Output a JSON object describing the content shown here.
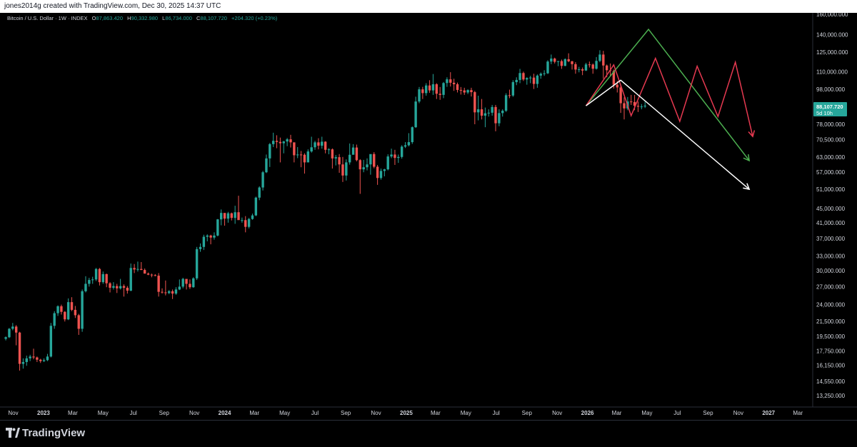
{
  "header": {
    "caption": "jones2014g created with TradingView.com, Dec 30, 2025 14:37 UTC"
  },
  "legend": {
    "symbol": "Bitcoin / U.S. Dollar · 1W · INDEX",
    "open_label": "O",
    "open": "87,863.420",
    "high_label": "H",
    "high": "90,332.980",
    "low_label": "L",
    "low": "86,734.000",
    "close_label": "C",
    "close": "88,107.720",
    "change": "+204.320 (+0.23%)"
  },
  "price_tag": {
    "price": "88,107.720",
    "countdown": "5d 10h"
  },
  "footer": {
    "brand": "TradingView"
  },
  "colors": {
    "up": "#26a69a",
    "down": "#ef5350",
    "background": "#000000",
    "green_path": "#4caf50",
    "red_path": "#e53950",
    "white_path": "#ffffff"
  },
  "chart_data": {
    "type": "candlestick",
    "timeframe": "1W",
    "scale": "log",
    "grid": false,
    "y_ticks": [
      13250,
      14550,
      16150,
      17750,
      19500,
      21500,
      24000,
      27000,
      30000,
      33000,
      37000,
      41000,
      45000,
      51000,
      57000,
      63000,
      70500,
      78000,
      88000,
      98000,
      110000,
      125000,
      140000,
      160000
    ],
    "y_tick_labels": [
      "13,250.000",
      "14,550.000",
      "16,150.000",
      "17,750.000",
      "19,500.000",
      "21,500.000",
      "24,000.000",
      "27,000.000",
      "30,000.000",
      "33,000.000",
      "37,000.000",
      "41,000.000",
      "45,000.000",
      "51,000.000",
      "57,000.000",
      "63,000.000",
      "70,500.000",
      "78,000.000",
      "88,000.000",
      "98,000.000",
      "110,000.000",
      "125,000.000",
      "140,000.000",
      "160,000.000"
    ],
    "x_ticks": [
      {
        "label": "Nov",
        "date": "2022-11-01"
      },
      {
        "label": "2023",
        "date": "2023-01-01"
      },
      {
        "label": "Mar",
        "date": "2023-03-01"
      },
      {
        "label": "May",
        "date": "2023-05-01"
      },
      {
        "label": "Jul",
        "date": "2023-07-01"
      },
      {
        "label": "Sep",
        "date": "2023-09-01"
      },
      {
        "label": "Nov",
        "date": "2023-11-01"
      },
      {
        "label": "2024",
        "date": "2024-01-01"
      },
      {
        "label": "Mar",
        "date": "2024-03-01"
      },
      {
        "label": "May",
        "date": "2024-05-01"
      },
      {
        "label": "Jul",
        "date": "2024-07-01"
      },
      {
        "label": "Sep",
        "date": "2024-09-01"
      },
      {
        "label": "Nov",
        "date": "2024-11-01"
      },
      {
        "label": "2025",
        "date": "2025-01-01"
      },
      {
        "label": "Mar",
        "date": "2025-03-01"
      },
      {
        "label": "May",
        "date": "2025-05-01"
      },
      {
        "label": "Jul",
        "date": "2025-07-01"
      },
      {
        "label": "Sep",
        "date": "2025-09-01"
      },
      {
        "label": "Nov",
        "date": "2025-11-01"
      },
      {
        "label": "2026",
        "date": "2026-01-01"
      },
      {
        "label": "Mar",
        "date": "2026-03-01"
      },
      {
        "label": "May",
        "date": "2026-05-01"
      },
      {
        "label": "Jul",
        "date": "2026-07-01"
      },
      {
        "label": "Sep",
        "date": "2026-09-01"
      },
      {
        "label": "Nov",
        "date": "2026-11-01"
      },
      {
        "label": "2027",
        "date": "2027-01-01"
      },
      {
        "label": "Mar",
        "date": "2027-03-01"
      }
    ],
    "x_range": [
      "2022-10-14",
      "2027-03-28"
    ],
    "candles_start": "2022-10-17",
    "candle_interval_days": 7,
    "candles": [
      [
        19200,
        19500,
        19000,
        19400
      ],
      [
        19400,
        20600,
        19300,
        20500
      ],
      [
        20500,
        21300,
        20300,
        20800
      ],
      [
        20800,
        21000,
        18400,
        20000
      ],
      [
        20000,
        20100,
        15600,
        16300
      ],
      [
        16300,
        16900,
        15800,
        16500
      ],
      [
        16500,
        17200,
        16100,
        16900
      ],
      [
        16900,
        17300,
        16600,
        17100
      ],
      [
        17100,
        18000,
        16800,
        17000
      ],
      [
        17000,
        17100,
        16500,
        16750
      ],
      [
        16750,
        16850,
        16400,
        16600
      ],
      [
        16600,
        16900,
        16500,
        16700
      ],
      [
        16700,
        17400,
        16600,
        17100
      ],
      [
        17100,
        21300,
        17000,
        20900
      ],
      [
        20900,
        23000,
        20500,
        22700
      ],
      [
        22700,
        23900,
        22300,
        23750
      ],
      [
        23750,
        24000,
        22500,
        22900
      ],
      [
        22900,
        23000,
        21500,
        21800
      ],
      [
        21800,
        25000,
        21700,
        24400
      ],
      [
        24400,
        25200,
        23000,
        23200
      ],
      [
        23200,
        23800,
        22000,
        22400
      ],
      [
        22400,
        22600,
        19700,
        20500
      ],
      [
        20500,
        26500,
        20100,
        26200
      ],
      [
        26200,
        28900,
        26000,
        27500
      ],
      [
        27500,
        28600,
        27000,
        28200
      ],
      [
        28200,
        28800,
        27500,
        28300
      ],
      [
        28300,
        30500,
        28000,
        30300
      ],
      [
        30300,
        30500,
        27200,
        27800
      ],
      [
        27800,
        29800,
        27500,
        29300
      ],
      [
        29300,
        29400,
        26900,
        27600
      ],
      [
        27600,
        27800,
        26000,
        26800
      ],
      [
        26800,
        27800,
        26500,
        27100
      ],
      [
        27100,
        27500,
        25900,
        26700
      ],
      [
        26700,
        28400,
        26500,
        27100
      ],
      [
        27100,
        27400,
        25300,
        26800
      ],
      [
        26800,
        27100,
        25800,
        26300
      ],
      [
        26300,
        31400,
        26200,
        30500
      ],
      [
        30500,
        31300,
        29500,
        30200
      ],
      [
        30200,
        31800,
        29800,
        30300
      ],
      [
        30300,
        31700,
        30100,
        30100
      ],
      [
        30100,
        30400,
        29400,
        29400
      ],
      [
        29400,
        29600,
        29100,
        29200
      ],
      [
        29200,
        29400,
        28700,
        29100
      ],
      [
        29100,
        29300,
        28900,
        29000
      ],
      [
        29000,
        29500,
        25300,
        26100
      ],
      [
        26100,
        26700,
        25800,
        26000
      ],
      [
        26000,
        28100,
        25500,
        25900
      ],
      [
        25900,
        26400,
        25700,
        26200
      ],
      [
        26200,
        26500,
        24900,
        25800
      ],
      [
        25800,
        26900,
        25600,
        26500
      ],
      [
        26500,
        28300,
        26400,
        27000
      ],
      [
        27000,
        28600,
        26700,
        28400
      ],
      [
        28400,
        28000,
        26500,
        27500
      ],
      [
        27500,
        28300,
        26600,
        26900
      ],
      [
        26900,
        28700,
        26800,
        28500
      ],
      [
        28500,
        35000,
        28200,
        34500
      ],
      [
        34500,
        35800,
        33900,
        35000
      ],
      [
        35000,
        37900,
        34300,
        37400
      ],
      [
        37400,
        38000,
        36300,
        37700
      ],
      [
        37700,
        37900,
        35600,
        37200
      ],
      [
        37200,
        38500,
        36700,
        37700
      ],
      [
        37700,
        42000,
        37500,
        41900
      ],
      [
        41900,
        44700,
        40300,
        43700
      ],
      [
        43700,
        43400,
        40200,
        42100
      ],
      [
        42100,
        44000,
        41000,
        43600
      ],
      [
        43600,
        43800,
        41600,
        42300
      ],
      [
        42300,
        45800,
        40700,
        43900
      ],
      [
        43900,
        48900,
        42000,
        41700
      ],
      [
        41700,
        42400,
        41000,
        41700
      ],
      [
        41700,
        42800,
        38500,
        39900
      ],
      [
        39900,
        42300,
        39500,
        42000
      ],
      [
        42000,
        43500,
        41800,
        43000
      ],
      [
        43000,
        48600,
        42800,
        48300
      ],
      [
        48300,
        52000,
        47500,
        51600
      ],
      [
        51600,
        57500,
        50600,
        57000
      ],
      [
        57000,
        64000,
        56700,
        62400
      ],
      [
        62400,
        69000,
        59000,
        68500
      ],
      [
        68500,
        73800,
        67200,
        70000
      ],
      [
        70000,
        72600,
        66700,
        69500
      ],
      [
        69500,
        71500,
        60800,
        68900
      ],
      [
        68900,
        70000,
        64500,
        69700
      ],
      [
        69700,
        71300,
        67600,
        70700
      ],
      [
        70700,
        72800,
        67000,
        69300
      ],
      [
        69300,
        69300,
        60800,
        63700
      ],
      [
        63700,
        67200,
        62500,
        64000
      ],
      [
        64000,
        65500,
        58900,
        63900
      ],
      [
        63900,
        64500,
        56500,
        60800
      ],
      [
        60800,
        66200,
        60800,
        65300
      ],
      [
        65300,
        71900,
        64800,
        67100
      ],
      [
        67100,
        70000,
        66000,
        69300
      ],
      [
        69300,
        71200,
        66200,
        67800
      ],
      [
        67800,
        71900,
        66500,
        69600
      ],
      [
        69600,
        69800,
        64500,
        66000
      ],
      [
        66000,
        66700,
        64100,
        66200
      ],
      [
        66200,
        66600,
        58400,
        62400
      ],
      [
        62400,
        63800,
        59600,
        62900
      ],
      [
        62900,
        64200,
        56800,
        60000
      ],
      [
        60000,
        63000,
        53500,
        55800
      ],
      [
        55800,
        62000,
        54000,
        60800
      ],
      [
        60800,
        68800,
        59900,
        63900
      ],
      [
        63900,
        68500,
        65600,
        67000
      ],
      [
        67000,
        68300,
        61200,
        61700
      ],
      [
        61700,
        62100,
        49500,
        58100
      ],
      [
        58100,
        61800,
        57000,
        58900
      ],
      [
        58900,
        62400,
        57700,
        60000
      ],
      [
        60000,
        61800,
        56100,
        64200
      ],
      [
        64200,
        65000,
        58500,
        59100
      ],
      [
        59100,
        59800,
        52500,
        54900
      ],
      [
        54900,
        58400,
        54300,
        57500
      ],
      [
        57500,
        58300,
        55500,
        58100
      ],
      [
        58100,
        64100,
        57700,
        63200
      ],
      [
        63200,
        66500,
        62500,
        64000
      ],
      [
        64000,
        66000,
        59800,
        62600
      ],
      [
        62600,
        64000,
        60600,
        63000
      ],
      [
        63000,
        68000,
        62300,
        67400
      ],
      [
        67400,
        69400,
        66800,
        68000
      ],
      [
        68000,
        73600,
        67500,
        69400
      ],
      [
        69400,
        76900,
        68600,
        76500
      ],
      [
        76500,
        93400,
        76200,
        90500
      ],
      [
        90500,
        99500,
        89500,
        98000
      ],
      [
        98000,
        99600,
        92000,
        95600
      ],
      [
        95600,
        102000,
        94000,
        100500
      ],
      [
        100500,
        104000,
        95800,
        97300
      ],
      [
        97300,
        108300,
        94500,
        101300
      ],
      [
        101300,
        102000,
        92000,
        95200
      ],
      [
        95200,
        99500,
        91500,
        94500
      ],
      [
        94500,
        102800,
        92500,
        102100
      ],
      [
        102100,
        106000,
        99600,
        104600
      ],
      [
        104600,
        109600,
        99800,
        102300
      ],
      [
        102300,
        105000,
        97000,
        101300
      ],
      [
        101300,
        102400,
        96000,
        97600
      ],
      [
        97600,
        99500,
        94700,
        97300
      ],
      [
        97300,
        99000,
        94500,
        96000
      ],
      [
        96000,
        98000,
        95000,
        97500
      ],
      [
        97500,
        99000,
        93500,
        96200
      ],
      [
        96200,
        97000,
        78000,
        84300
      ],
      [
        84300,
        94000,
        80000,
        86000
      ],
      [
        86000,
        92000,
        80500,
        82500
      ],
      [
        82500,
        87000,
        76500,
        83800
      ],
      [
        83800,
        86000,
        82000,
        84100
      ],
      [
        84100,
        88500,
        82500,
        87300
      ],
      [
        87300,
        88500,
        74500,
        78500
      ],
      [
        78500,
        86000,
        77000,
        83900
      ],
      [
        83900,
        86000,
        82000,
        85200
      ],
      [
        85200,
        95500,
        84500,
        94300
      ],
      [
        94300,
        97800,
        92500,
        94100
      ],
      [
        94100,
        104000,
        93300,
        102700
      ],
      [
        102700,
        106000,
        100700,
        104200
      ],
      [
        104200,
        112000,
        102000,
        109000
      ],
      [
        109000,
        110000,
        103500,
        104500
      ],
      [
        104500,
        106000,
        101000,
        105500
      ],
      [
        105500,
        107000,
        102000,
        105800
      ],
      [
        105800,
        108500,
        98200,
        101500
      ],
      [
        101500,
        108000,
        99000,
        107200
      ],
      [
        107200,
        109400,
        105000,
        108500
      ],
      [
        108500,
        111000,
        107000,
        108800
      ],
      [
        108800,
        118500,
        108300,
        117500
      ],
      [
        117500,
        123000,
        115500,
        119800
      ],
      [
        119800,
        120500,
        116000,
        117300
      ],
      [
        117300,
        118000,
        114000,
        117800
      ],
      [
        117800,
        119000,
        112000,
        114200
      ],
      [
        114200,
        120000,
        114000,
        119300
      ],
      [
        119300,
        124000,
        117000,
        117700
      ],
      [
        117700,
        118000,
        111500,
        115500
      ],
      [
        115500,
        117000,
        108500,
        111500
      ],
      [
        111500,
        113500,
        109500,
        111700
      ],
      [
        111700,
        113000,
        107500,
        110800
      ],
      [
        110800,
        116500,
        110500,
        115300
      ],
      [
        115300,
        117500,
        113000,
        115200
      ],
      [
        115200,
        116000,
        108500,
        112100
      ],
      [
        112100,
        121000,
        111500,
        118000
      ],
      [
        118000,
        126500,
        117000,
        123000
      ],
      [
        123000,
        126000,
        105000,
        114500
      ],
      [
        114500,
        115200,
        106000,
        111000
      ],
      [
        111000,
        116000,
        107000,
        110500
      ],
      [
        110500,
        111500,
        98500,
        101000
      ],
      [
        101000,
        103500,
        96000,
        99200
      ],
      [
        99200,
        100500,
        84000,
        89500
      ],
      [
        89500,
        93000,
        80500,
        86500
      ],
      [
        86500,
        93200,
        85500,
        90500
      ],
      [
        90500,
        94500,
        88500,
        90200
      ],
      [
        90200,
        94500,
        85500,
        88000
      ],
      [
        88000,
        90500,
        84500,
        87500
      ],
      [
        87500,
        89000,
        86000,
        87600
      ],
      [
        87600,
        90332,
        86734,
        88107
      ]
    ],
    "projections": [
      {
        "color": "green",
        "points": [
          [
            "2025-12-29",
            88000
          ],
          [
            "2026-05-04",
            145000
          ],
          [
            "2026-11-23",
            61500
          ]
        ]
      },
      {
        "color": "red",
        "points": [
          [
            "2025-12-29",
            88000
          ],
          [
            "2026-02-23",
            115000
          ],
          [
            "2026-03-30",
            82500
          ],
          [
            "2026-05-18",
            120000
          ],
          [
            "2026-07-06",
            79500
          ],
          [
            "2026-08-10",
            114000
          ],
          [
            "2026-09-21",
            82000
          ],
          [
            "2026-10-26",
            117000
          ],
          [
            "2026-11-30",
            72000
          ]
        ]
      },
      {
        "color": "white",
        "points": [
          [
            "2025-12-29",
            88000
          ],
          [
            "2026-03-09",
            104000
          ],
          [
            "2026-11-23",
            51000
          ]
        ]
      }
    ]
  }
}
